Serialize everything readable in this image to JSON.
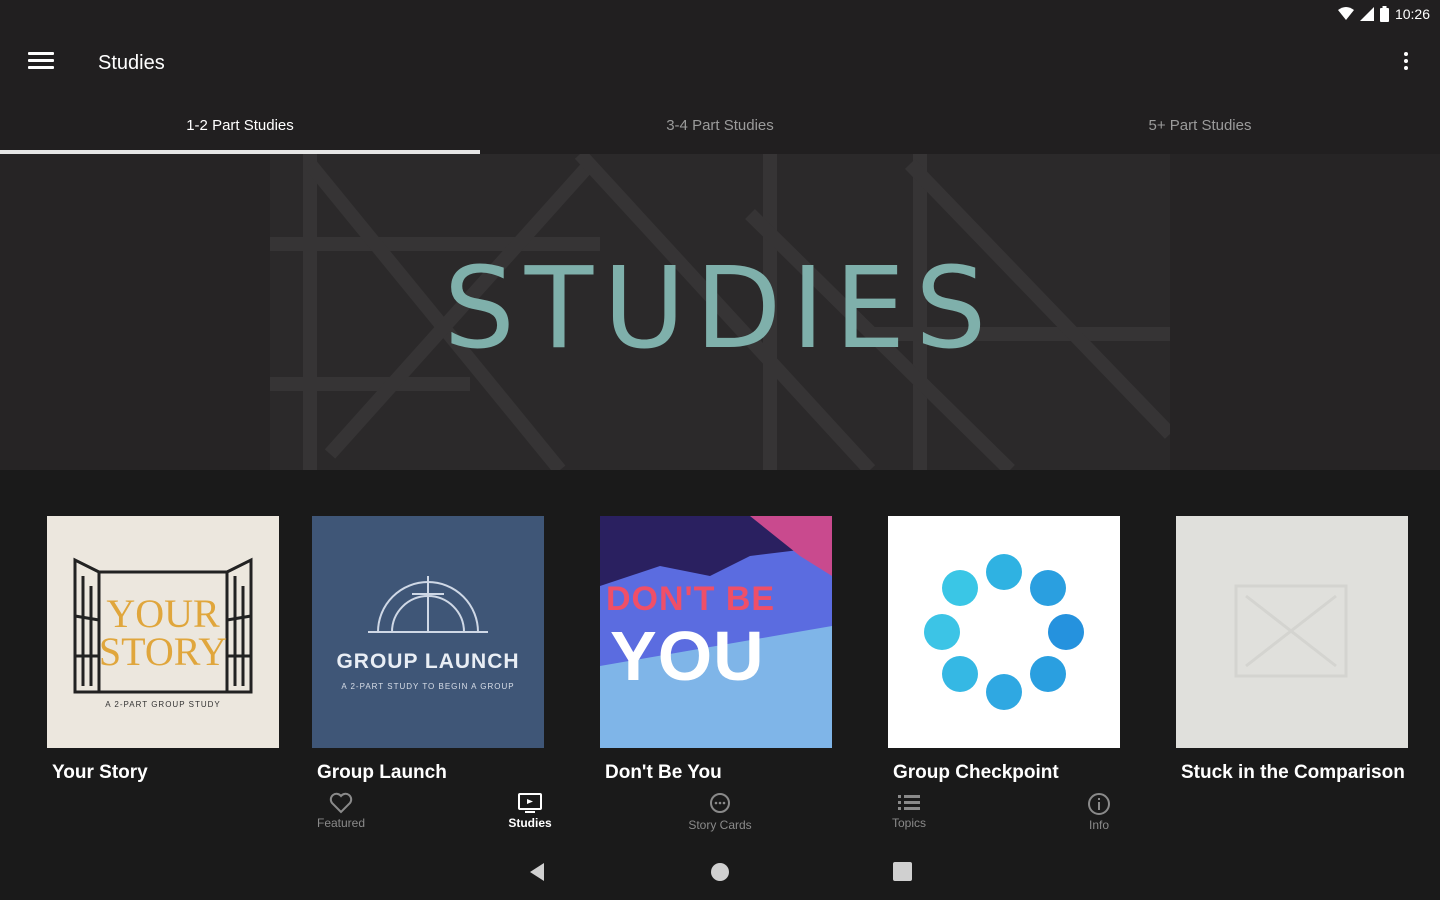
{
  "status_bar": {
    "time": "10:26",
    "icons": [
      "wifi-icon",
      "signal-icon",
      "battery-icon"
    ]
  },
  "app_bar": {
    "title": "Studies",
    "menu_icon": "hamburger-menu-icon",
    "overflow_icon": "more-vert-icon"
  },
  "tabs": [
    {
      "label": "1-2 Part Studies",
      "active": true
    },
    {
      "label": "3-4 Part Studies",
      "active": false
    },
    {
      "label": "5+ Part Studies",
      "active": false
    }
  ],
  "hero": {
    "title": "STUDIES"
  },
  "studies": [
    {
      "title": "Your Story",
      "art": {
        "line1": "YOUR",
        "line2": "STORY",
        "sub": "A 2-PART GROUP STUDY"
      }
    },
    {
      "title": "Group Launch",
      "art": {
        "headline": "GROUP LAUNCH",
        "sub": "A 2-PART STUDY TO BEGIN A GROUP"
      }
    },
    {
      "title": "Don't Be You",
      "art": {
        "line1": "DON'T BE",
        "line2": "YOU"
      }
    },
    {
      "title": "Group Checkpoint"
    },
    {
      "title": "Stuck in the Comparison"
    }
  ],
  "bottom_nav": [
    {
      "label": "Featured",
      "icon": "heart-icon",
      "active": false
    },
    {
      "label": "Studies",
      "icon": "tv-icon",
      "active": true
    },
    {
      "label": "Story Cards",
      "icon": "chat-bubble-icon",
      "active": false
    },
    {
      "label": "Topics",
      "icon": "list-icon",
      "active": false
    },
    {
      "label": "Info",
      "icon": "info-icon",
      "active": false
    }
  ],
  "system_nav": [
    "back-icon",
    "home-icon",
    "recents-icon"
  ],
  "colors": {
    "hero_title": "#7fb0ab",
    "app_bar": "#211f20",
    "background": "#1a1a1a"
  }
}
